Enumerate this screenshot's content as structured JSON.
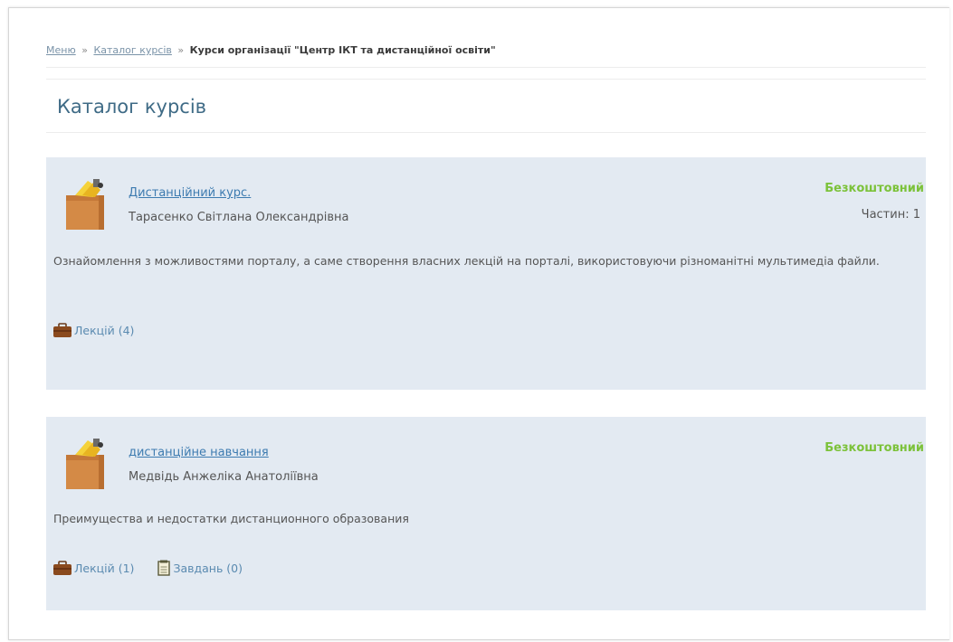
{
  "breadcrumb": {
    "home": "Меню",
    "catalog": "Каталог курсів",
    "separator": "»",
    "current": "Курси організації \"Центр ІКТ та дистанційної освіти\""
  },
  "page_title": "Каталог курсів",
  "courses": [
    {
      "title": "Дистанційний курс.",
      "author": "Тарасенко Світлана Олександрівна",
      "price": "Безкоштовний",
      "participants": "Частин: 1",
      "description": "Ознайомлення з можливостями порталу, а саме створення власних лекцій на порталі, використовуючи різноманітні мультимедіа файли.",
      "lectures": "Лекцій (4)"
    },
    {
      "title": "дистанційне навчання",
      "author": "Медвідь Анжеліка Анатоліївна",
      "price": "Безкоштовний",
      "description": "Преимущества и недостатки дистанционного образования",
      "lectures": "Лекцій (1)",
      "tasks": "Завдань (0)"
    }
  ],
  "icons": {
    "course": "course-box-icon",
    "lectures": "briefcase-icon",
    "tasks": "notepad-icon"
  },
  "colors": {
    "title": "#3f6b86",
    "link": "#3d7bb0",
    "price": "#7cc23a",
    "card_bg": "#e3eaf2"
  }
}
